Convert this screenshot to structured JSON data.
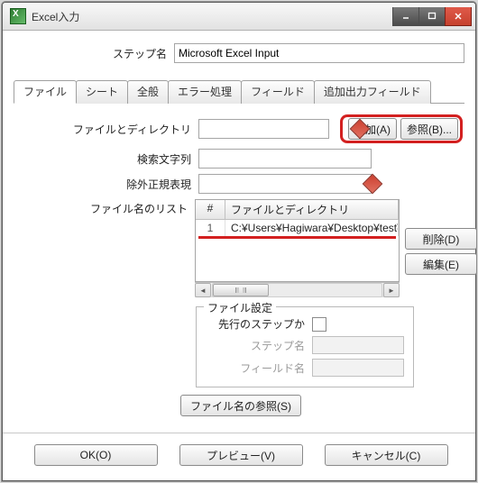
{
  "window": {
    "title": "Excel入力"
  },
  "header": {
    "step_label": "ステップ名",
    "step_value": "Microsoft Excel Input"
  },
  "tabs": [
    "ファイル",
    "シート",
    "全般",
    "エラー処理",
    "フィールド",
    "追加出力フィールド"
  ],
  "file": {
    "filedir_label": "ファイルとディレクトリ",
    "search_label": "検索文字列",
    "exclude_label": "除外正規表現",
    "list_label": "ファイル名のリスト",
    "add_btn": "追加(A)",
    "browse_btn": "参照(B)...",
    "table": {
      "col_num": "#",
      "col_path": "ファイルとディレクトリ",
      "row1_num": "1",
      "row1_path": "C:¥Users¥Hagiwara¥Desktop¥test¥N"
    },
    "delete_btn": "削除(D)",
    "edit_btn": "編集(E)"
  },
  "settings": {
    "legend": "ファイル設定",
    "prev_step_label": "先行のステップか",
    "step_name_label": "ステップ名",
    "field_name_label": "フィールド名"
  },
  "buttons": {
    "browse_names": "ファイル名の参照(S)",
    "ok": "OK(O)",
    "preview": "プレビュー(V)",
    "cancel": "キャンセル(C)"
  }
}
